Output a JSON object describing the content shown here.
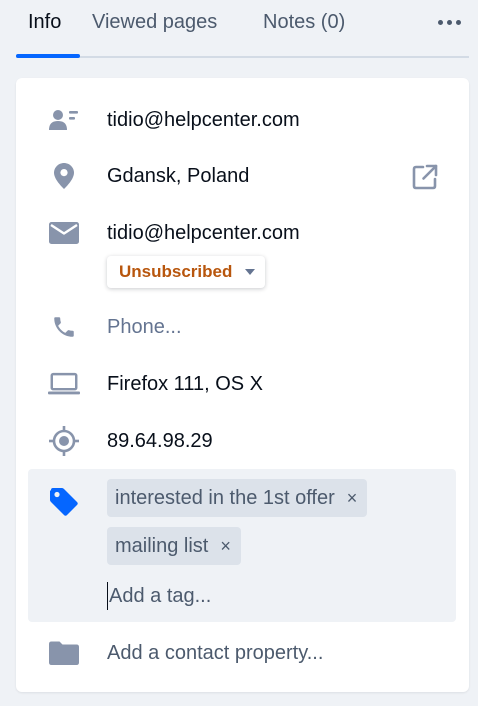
{
  "tabs": [
    {
      "label": "Info",
      "active": true
    },
    {
      "label": "Viewed pages",
      "active": false
    },
    {
      "label": "Notes (0)",
      "active": false
    }
  ],
  "more_icon": "more-horizontal-icon",
  "details": {
    "contact": {
      "icon": "contact-card-icon",
      "value": "tidio@helpcenter.com"
    },
    "location": {
      "icon": "location-pin-icon",
      "value": "Gdansk, Poland",
      "action_icon": "open-external-icon"
    },
    "email": {
      "icon": "envelope-icon",
      "value": "tidio@helpcenter.com",
      "subscription": "Unsubscribed"
    },
    "phone": {
      "icon": "phone-icon",
      "placeholder": "Phone..."
    },
    "browser": {
      "icon": "laptop-icon",
      "value": "Firefox 111, OS X"
    },
    "ip": {
      "icon": "target-icon",
      "value": "89.64.98.29"
    }
  },
  "tags": {
    "icon": "tag-icon",
    "items": [
      "interested in the 1st offer",
      "mailing list"
    ],
    "remove_glyph": "×",
    "input_placeholder": "Add a tag..."
  },
  "add_property": {
    "icon": "folder-icon",
    "label": "Add a contact property..."
  },
  "colors": {
    "accent": "#0566ff",
    "unsubscribed": "#b8560d",
    "icon_gray": "#8894ab",
    "tag_bg": "#dce2ea"
  }
}
